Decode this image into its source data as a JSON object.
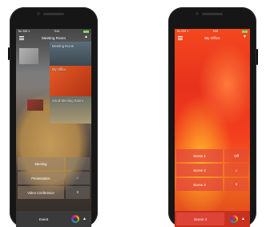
{
  "left_phone": {
    "status": {
      "carrier": "No SIM ✈",
      "time": "9:44"
    },
    "nav": {
      "title": "Meeting Room"
    },
    "rooms": [
      {
        "label": "Meeting Room"
      },
      {
        "label": "My Office"
      },
      {
        "label": "Small Meeting Room"
      }
    ],
    "scenes": [
      {
        "label": "Meeting",
        "side": ""
      },
      {
        "label": "Presentation",
        "side": "⌂"
      },
      {
        "label": "Video Conference",
        "side": "∨"
      }
    ],
    "bottom": {
      "label": "Event"
    }
  },
  "right_phone": {
    "status": {
      "carrier": "No SIM ✈",
      "time": "9:58"
    },
    "nav": {
      "title": "My Office"
    },
    "scenes": [
      {
        "label": "Scene 1",
        "side": "Off"
      },
      {
        "label": "Scene 2",
        "side": "⌂"
      },
      {
        "label": "Scene 3",
        "side": "∨"
      }
    ],
    "bottom": {
      "label": "Scene 4"
    }
  }
}
